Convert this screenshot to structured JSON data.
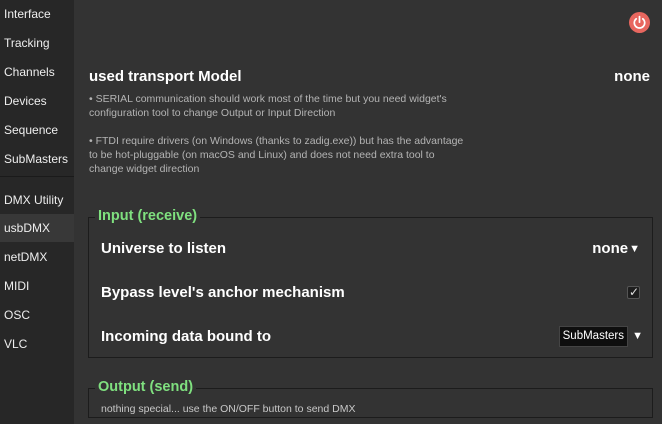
{
  "sidebar": {
    "items": [
      {
        "label": "Interface"
      },
      {
        "label": "Tracking"
      },
      {
        "label": "Channels"
      },
      {
        "label": "Devices"
      },
      {
        "label": "Sequence"
      },
      {
        "label": "SubMasters"
      },
      {
        "label": "DMX Utility"
      },
      {
        "label": "usbDMX"
      },
      {
        "label": "netDMX"
      },
      {
        "label": "MIDI"
      },
      {
        "label": "OSC"
      },
      {
        "label": "VLC"
      }
    ],
    "active": "usbDMX"
  },
  "header": {
    "power_icon": "power-icon",
    "power_color": "#e8675f"
  },
  "transport": {
    "title": "used transport Model",
    "value": "none",
    "desc1_line1": "• SERIAL communication should work most of the time but you need widget's",
    "desc1_line2": "configuration tool to change Output or Input Direction",
    "desc2_line1": "• FTDI require drivers (on Windows (thanks to zadig.exe)) but has the advantage",
    "desc2_line2": "to be hot-pluggable (on macOS and Linux) and does not need extra tool to",
    "desc2_line3": "change widget direction"
  },
  "input_group": {
    "title": "Input (receive)",
    "title_color": "#7fe07f",
    "universe_label": "Universe to listen",
    "universe_value": "none",
    "bypass_label": "Bypass level's anchor mechanism",
    "bypass_checked": true,
    "bound_label": "Incoming data bound to",
    "bound_value": "SubMasters"
  },
  "output_group": {
    "title": "Output (send)",
    "desc": "nothing special... use the ON/OFF button to send DMX"
  }
}
